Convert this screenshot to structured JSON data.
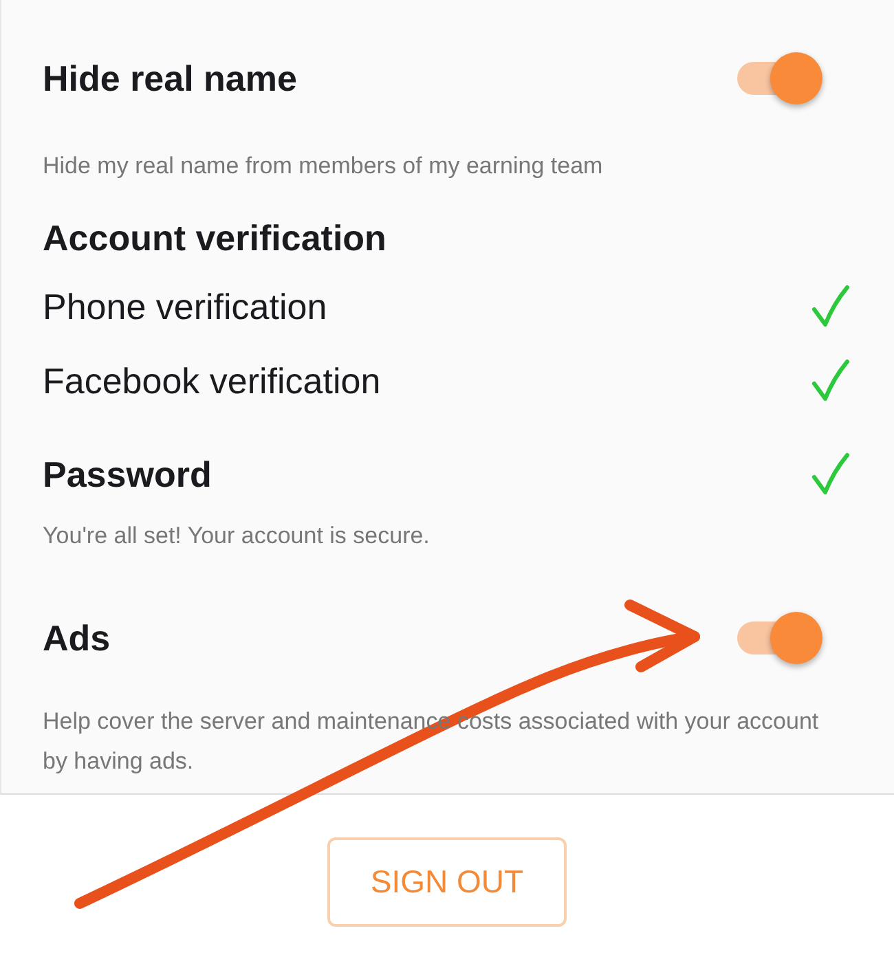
{
  "settings": [
    {
      "kind": "toggle",
      "title": "Hide real name",
      "on": true,
      "description": "Hide my real name from members of my earning team"
    },
    {
      "kind": "heading",
      "title": "Account verification"
    },
    {
      "kind": "check",
      "title": "Phone verification",
      "verified": true
    },
    {
      "kind": "check",
      "title": "Facebook verification",
      "verified": true
    },
    {
      "kind": "check_heading",
      "title": "Password",
      "verified": true,
      "description": "You're all set! Your account is secure."
    },
    {
      "kind": "toggle",
      "title": "Ads",
      "on": true,
      "description": "Help cover the server and maintenance costs associated with your account by having ads."
    }
  ],
  "sign_out_button": "SIGN OUT"
}
